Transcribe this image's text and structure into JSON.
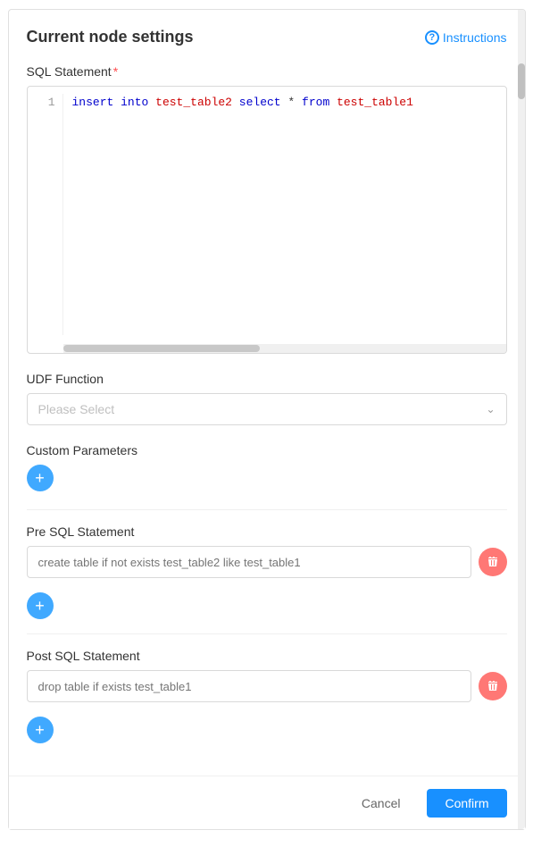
{
  "header": {
    "title": "Current node settings",
    "instructions_label": "Instructions"
  },
  "sql_statement": {
    "label": "SQL Statement",
    "required": true,
    "line_number": "1",
    "code_parts": [
      {
        "text": "insert",
        "type": "keyword"
      },
      {
        "text": " ",
        "type": "plain"
      },
      {
        "text": "into",
        "type": "keyword"
      },
      {
        "text": " ",
        "type": "plain"
      },
      {
        "text": "test_table2",
        "type": "table"
      },
      {
        "text": " ",
        "type": "plain"
      },
      {
        "text": "select",
        "type": "keyword"
      },
      {
        "text": " ",
        "type": "plain"
      },
      {
        "text": "*",
        "type": "operator"
      },
      {
        "text": " ",
        "type": "plain"
      },
      {
        "text": "from",
        "type": "keyword"
      },
      {
        "text": " ",
        "type": "plain"
      },
      {
        "text": "test_table1",
        "type": "table"
      }
    ]
  },
  "udf": {
    "label": "UDF Function",
    "placeholder": "Please Select"
  },
  "custom_params": {
    "label": "Custom Parameters"
  },
  "pre_sql": {
    "label": "Pre SQL Statement",
    "placeholder": "create table if not exists test_table2 like test_table1"
  },
  "post_sql": {
    "label": "Post SQL Statement",
    "placeholder": "drop table if exists test_table1"
  },
  "footer": {
    "cancel_label": "Cancel",
    "confirm_label": "Confirm"
  },
  "colors": {
    "blue": "#1890ff",
    "light_blue": "#40a9ff",
    "red": "#ff7875",
    "required": "#ff4d4f"
  }
}
